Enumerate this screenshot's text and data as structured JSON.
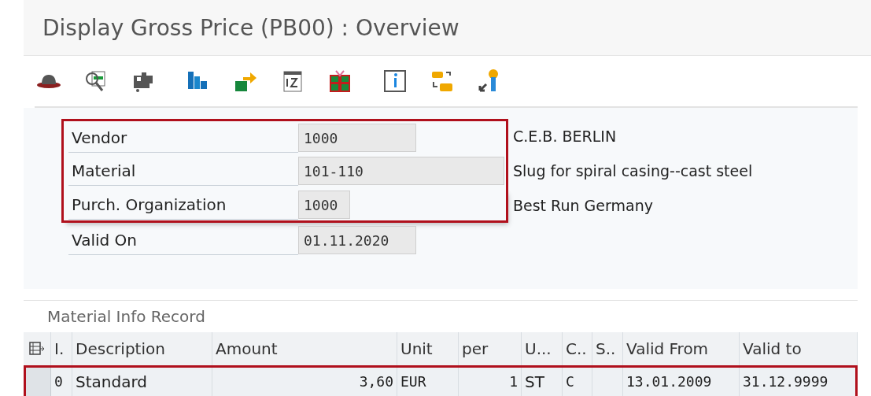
{
  "window": {
    "title": "Display Gross Price (PB00) : Overview"
  },
  "toolbar": {
    "groups": [
      [
        {
          "kind": "hat"
        },
        {
          "kind": "magnifier"
        },
        {
          "kind": "puzzle"
        }
      ],
      [
        {
          "kind": "bars"
        },
        {
          "kind": "arrow"
        },
        {
          "kind": "calendar"
        },
        {
          "kind": "gift"
        }
      ],
      [
        {
          "kind": "info"
        },
        {
          "kind": "connector"
        },
        {
          "kind": "key"
        }
      ]
    ]
  },
  "form": {
    "fields": [
      {
        "label": "Vendor",
        "value": "1000",
        "description": "C.E.B. BERLIN",
        "highlighted": true
      },
      {
        "label": "Material",
        "value": "101-110",
        "description": "Slug for spiral casing--cast steel",
        "highlighted": true
      },
      {
        "label": "Purch. Organization",
        "value": "1000",
        "description": "Best Run Germany",
        "highlighted": true
      },
      {
        "label": "Valid On",
        "value": "01.11.2020",
        "highlighted": false
      }
    ]
  },
  "table": {
    "title": "Material Info Record",
    "columns": [
      "I.",
      "Description",
      "Amount",
      "Unit",
      "per",
      "U...",
      "C..",
      "S..",
      "Valid From",
      "Valid to"
    ],
    "rows": [
      {
        "highlighted": true,
        "cells": [
          "0",
          "Standard",
          "3,60",
          "EUR",
          "1",
          "ST",
          "C",
          "",
          "13.01.2009",
          "31.12.9999"
        ]
      }
    ]
  }
}
